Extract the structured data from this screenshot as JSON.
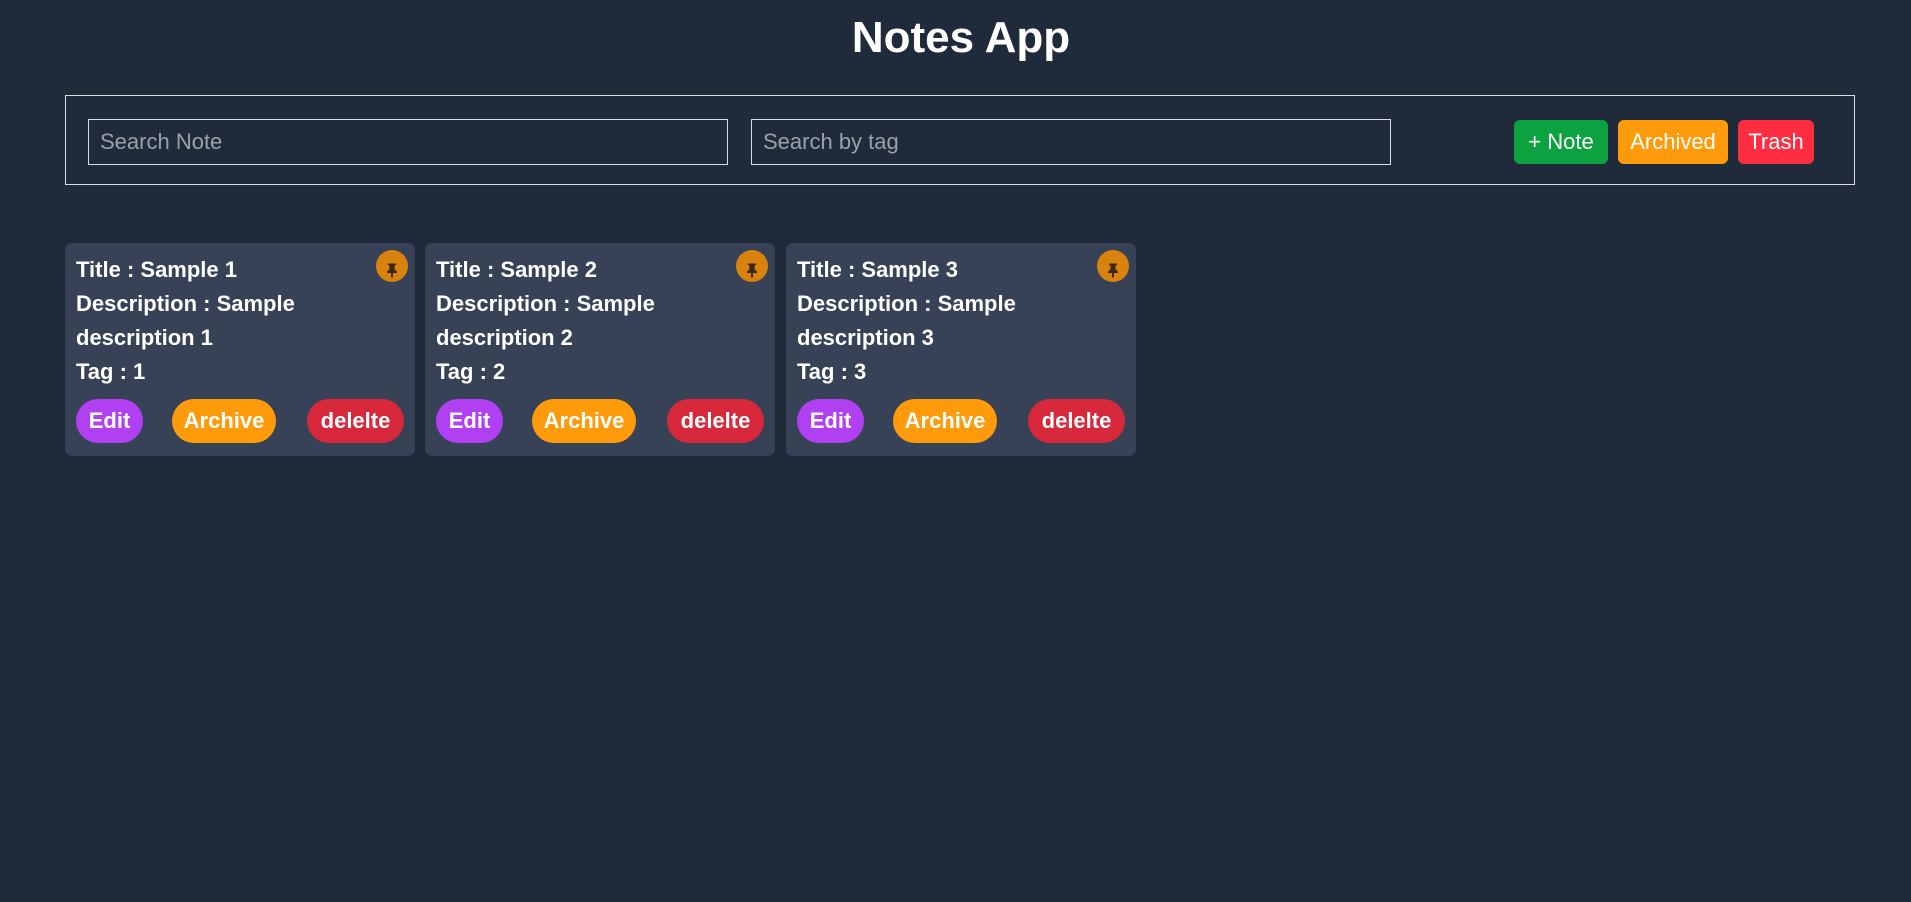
{
  "app": {
    "title": "Notes App"
  },
  "toolbar": {
    "search_note_placeholder": "Search Note",
    "search_tag_placeholder": "Search by tag",
    "add_note_label": "+ Note",
    "archived_label": "Archived",
    "trash_label": "Trash"
  },
  "labels": {
    "title": "Title : ",
    "description": "Description : ",
    "tag": "Tag : ",
    "edit": "Edit",
    "archive": "Archive",
    "delete": "delelte"
  },
  "notes": [
    {
      "title": "Sample 1",
      "description": "Sample description 1",
      "tag": "1"
    },
    {
      "title": "Sample 2",
      "description": "Sample description 2",
      "tag": "2"
    },
    {
      "title": "Sample 3",
      "description": "Sample description 3",
      "tag": "3"
    }
  ],
  "icons": {
    "pin": "pin-icon"
  },
  "colors": {
    "background": "#1f2a3b",
    "card": "#374256",
    "add_note": "#0ba23f",
    "archived": "#ff9a0a",
    "trash": "#ff2d42",
    "edit": "#b040f2",
    "archive": "#ff9a0a",
    "delete": "#d7283c",
    "pin": "#d9820e",
    "pin_glyph": "#3c2a10"
  }
}
